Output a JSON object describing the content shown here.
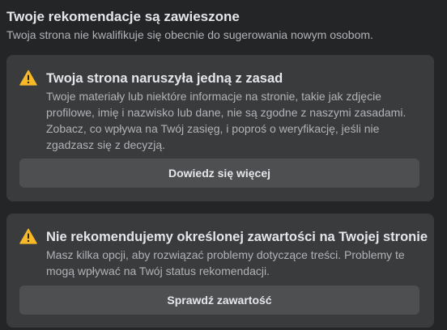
{
  "header": {
    "title": "Twoje rekomendacje są zawieszone",
    "subtitle": "Twoja strona nie kwalifikuje się obecnie do sugerowania nowym osobom."
  },
  "cards": [
    {
      "icon": "warning-icon",
      "title": "Twoja strona naruszyła jedną z zasad",
      "body": "Twoje materiały lub niektóre informacje na stronie, takie jak zdjęcie profilowe, imię i nazwisko lub dane, nie są zgodne z naszymi zasadami. Zobacz, co wpływa na Twój zasięg, i poproś o weryfikację, jeśli nie zgadzasz się z decyzją.",
      "button_label": "Dowiedz się więcej"
    },
    {
      "icon": "warning-icon",
      "title": "Nie rekomendujemy określonej zawartości na Twojej stronie",
      "body": "Masz kilka opcji, aby rozwiązać problemy dotyczące treści. Problemy te mogą wpływać na Twój status rekomendacji.",
      "button_label": "Sprawdź zawartość"
    }
  ],
  "colors": {
    "background": "#242526",
    "card": "#3a3b3c",
    "button": "#4e4f50",
    "warning": "#f7b928",
    "text_primary": "#e4e6eb",
    "text_secondary": "#b0b3b8"
  }
}
